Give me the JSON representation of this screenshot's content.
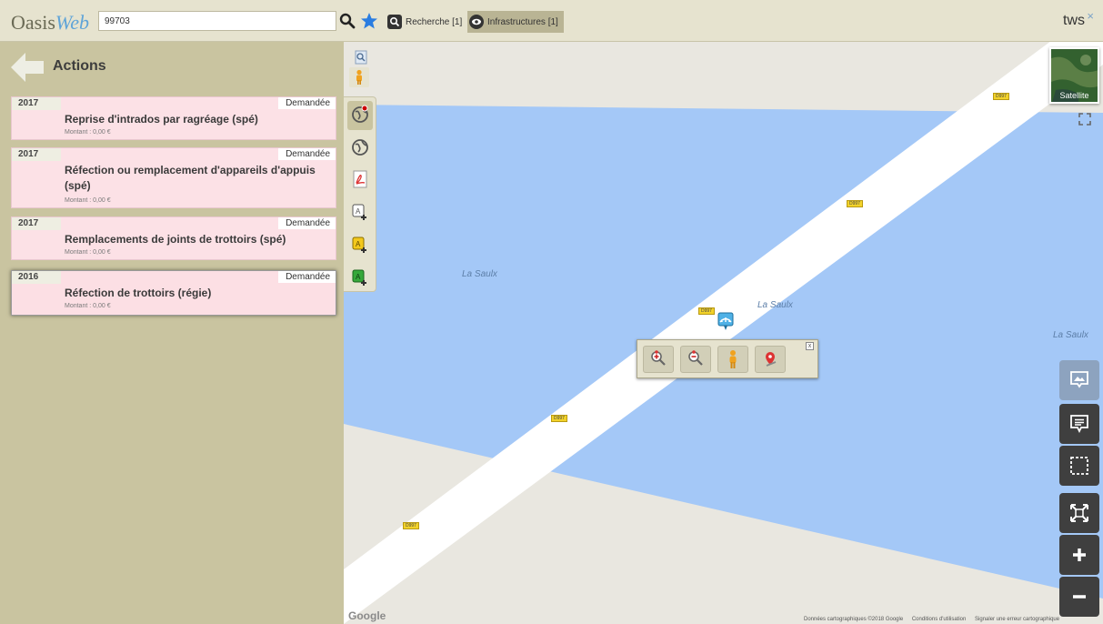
{
  "header": {
    "logo_main": "Oasis",
    "logo_suffix": "Web",
    "search_value": "99703",
    "tabs": [
      {
        "label": "Recherche [1]",
        "icon": "search-icon"
      },
      {
        "label": "Infrastructures [1]",
        "icon": "eye-icon"
      }
    ],
    "user": "tws",
    "close_glyph": "×"
  },
  "panel": {
    "title": "Actions",
    "cards": [
      {
        "year": "2017",
        "status": "Demandée",
        "title": "Reprise d'intrados par ragréage (spé)",
        "amount": "Montant : 0,00 €"
      },
      {
        "year": "2017",
        "status": "Demandée",
        "title": "Réfection ou remplacement d'appareils d'appuis (spé)",
        "amount": "Montant : 0,00 €"
      },
      {
        "year": "2017",
        "status": "Demandée",
        "title": "Remplacements de joints de trottoirs (spé)",
        "amount": "Montant : 0,00 €"
      },
      {
        "year": "2016",
        "status": "Demandée",
        "title": "Réfection de trottoirs (régie)",
        "amount": "Montant : 0,00 €"
      }
    ]
  },
  "map": {
    "road_labels": [
      "D997",
      "D997",
      "D997",
      "D997",
      "D997"
    ],
    "river_labels": [
      "La Saulx",
      "La Saulx",
      "La Saulx"
    ],
    "satellite_label": "Satellite",
    "google": "Google",
    "attribution": [
      "Données cartographiques ©2018 Google",
      "Conditions d'utilisation",
      "Signaler une erreur cartographique"
    ],
    "colors": {
      "water": "#a4c8f7",
      "land": "#e9e7e0",
      "road": "#ffffff",
      "road_label": "#f2d22a"
    }
  },
  "popup": {
    "buttons": [
      "zoom-in-icon",
      "zoom-out-icon",
      "street-view-icon",
      "place-marker-icon"
    ],
    "close": "x"
  }
}
